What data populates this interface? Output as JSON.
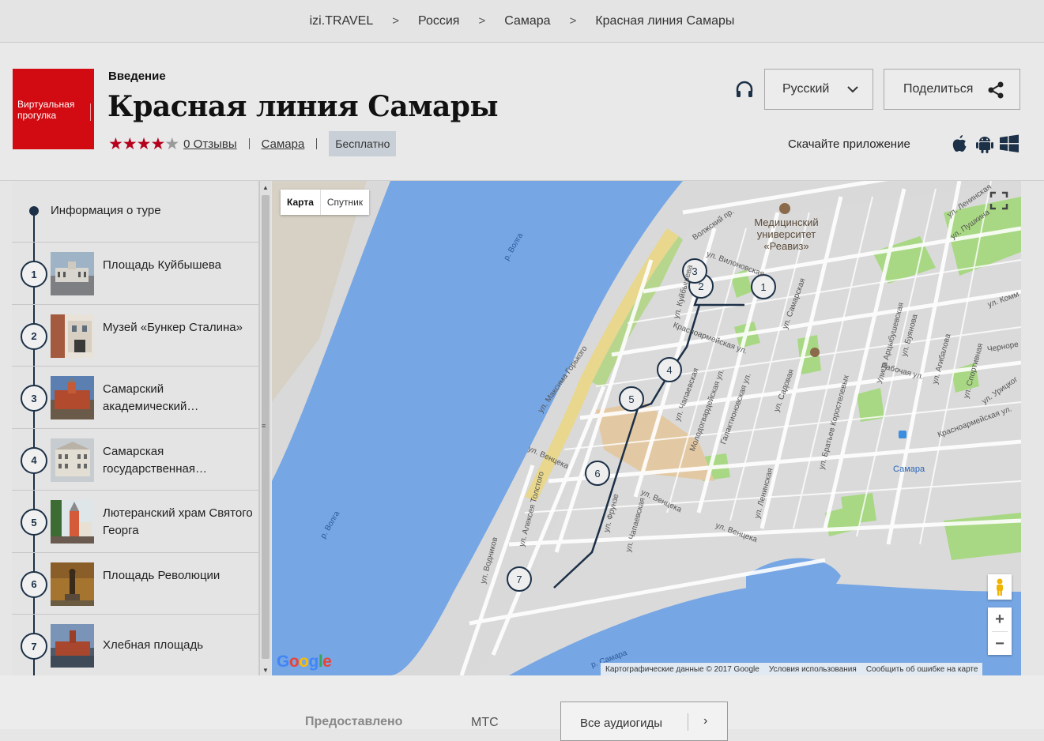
{
  "breadcrumbs": [
    "izi.TRAVEL",
    "Россия",
    "Самара",
    "Красная линия Самары"
  ],
  "header": {
    "logo_text": "Виртуальная прогулка",
    "kicker": "Введение",
    "title": "Красная линия Самары",
    "rating": 4,
    "rating_max": 5,
    "reviews_link": "0 Отзывы",
    "city_link": "Самара",
    "price_badge": "Бесплатно",
    "language": "Русский",
    "share_label": "Поделиться",
    "download_label": "Скачайте приложение"
  },
  "sidebar": {
    "info_label": "Информация о туре",
    "stops": [
      {
        "num": "1",
        "label": "Площадь Куйбышева"
      },
      {
        "num": "2",
        "label": "Музей «Бункер Сталина»"
      },
      {
        "num": "3",
        "label": "Самарский академический…"
      },
      {
        "num": "4",
        "label": "Самарская государственная…"
      },
      {
        "num": "5",
        "label": "Лютеранский храм Святого Георга"
      },
      {
        "num": "6",
        "label": "Площадь Революции"
      },
      {
        "num": "7",
        "label": "Хлебная площадь"
      }
    ]
  },
  "map": {
    "tab_map": "Карта",
    "tab_satellite": "Спутник",
    "markers": [
      "1",
      "2",
      "3",
      "4",
      "5",
      "6",
      "7"
    ],
    "poi_label": "Медицинский университет «Реавиз»",
    "station_label": "Самара",
    "river_label_1": "р. Волга",
    "river_label_2": "р. Волга",
    "river_label_3": "р. Самара",
    "streets": {
      "volzhsky": "Волжский пр.",
      "vilonovskaya": "ул. Вилоновская",
      "gorkogo": "ул. Максима Горького",
      "krasnoarmeyskaya": "Красноармейская ул.",
      "chapaevskaya": "ул. Чапаевская",
      "molodogvardeyskaya": "Молодогвардейская ул.",
      "galaktionovskaya": "Галактионовская ул.",
      "sadovaya": "ул. Садовая",
      "samarskaya": "ул. Самарская",
      "ventsека": "ул. Венцека",
      "venceka2": "ул. Венцека",
      "venceka3": "ул. Венцека",
      "tolstogo": "ул. Алексея Толстого",
      "vodnikov": "ул. Водников",
      "frunze": "ул. Фрунзе",
      "chapaevskaya2": "ул. Чапаевская",
      "leninskaya": "ул. Ленинская",
      "korostelevyh": "ул. Братьев Коростелевых",
      "arcybushevskaya": "Улица Арцыбушевская",
      "rabochaya": "Рабочая ул.",
      "buyanova": "ул. Буянова",
      "agibalova": "ул. Агибалова",
      "sportivnaya": "ул. Спортивная",
      "krasnoarmeyskaya2": "Красноармейская ул.",
      "kuibysheva": "ул. Куйбышева",
      "leninskaya_top": "ул. Ленинская",
      "pushkina": "ул. Пушкина",
      "kommunisticheskaya": "ул. Комм",
      "chernorechenskaya": "Черноре",
      "uritskogo": "ул. Урицког"
    },
    "attribution": "Картографические данные © 2017 Google",
    "terms": "Условия использования",
    "report": "Сообщить об ошибке на карте",
    "google_logo": "Google",
    "zoom_in": "+",
    "zoom_out": "−"
  },
  "footer": {
    "provided": "Предоставлено",
    "provider": "МТС",
    "all_guides": "Все аудиогиды"
  },
  "colors": {
    "brand_red": "#d20a11",
    "star_red": "#b6001c",
    "route": "#1c3047",
    "water": "#76a6e4",
    "park": "#a8d883"
  }
}
